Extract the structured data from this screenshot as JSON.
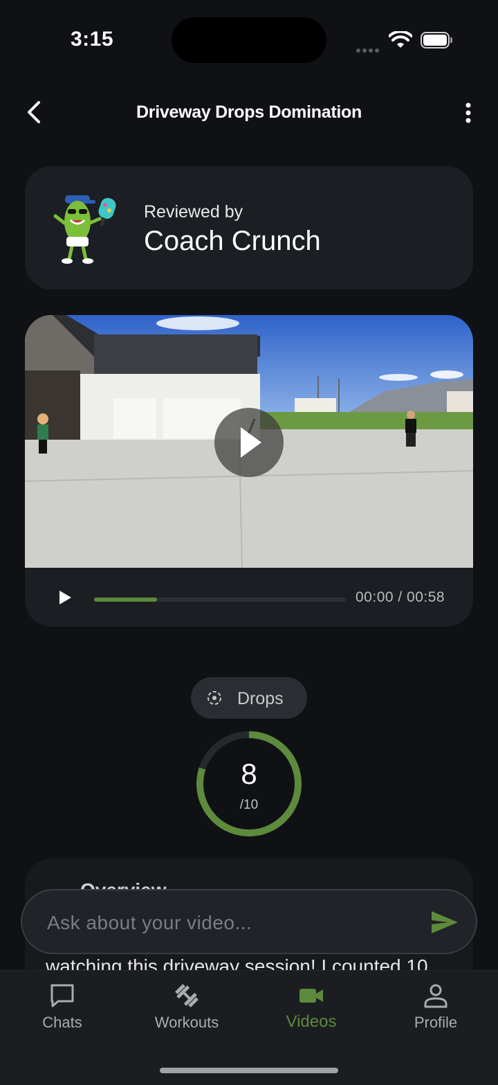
{
  "status_bar": {
    "time": "3:15"
  },
  "header": {
    "title": "Driveway Drops Domination"
  },
  "coach": {
    "reviewed_label": "Reviewed by",
    "name": "Coach Crunch"
  },
  "video": {
    "time_readout": "00:00 / 00:58",
    "progress": 0.25
  },
  "skill": {
    "label": "Drops",
    "score": "8",
    "max": "/10",
    "score_fraction": 0.8
  },
  "overview": {
    "title": "Overview",
    "snippet": "watching this driveway session! I counted 10"
  },
  "chat": {
    "placeholder": "Ask about your video..."
  },
  "tabs": [
    {
      "label": "Chats",
      "icon": "chat-bubble-icon",
      "active": false
    },
    {
      "label": "Workouts",
      "icon": "dumbbell-icon",
      "active": false
    },
    {
      "label": "Videos",
      "icon": "video-camera-icon",
      "active": true
    },
    {
      "label": "Profile",
      "icon": "person-icon",
      "active": false
    }
  ],
  "colors": {
    "accent": "#5d8a3c",
    "ring_track": "#25292d",
    "background": "#0f1114",
    "card": "#1b1e22"
  }
}
